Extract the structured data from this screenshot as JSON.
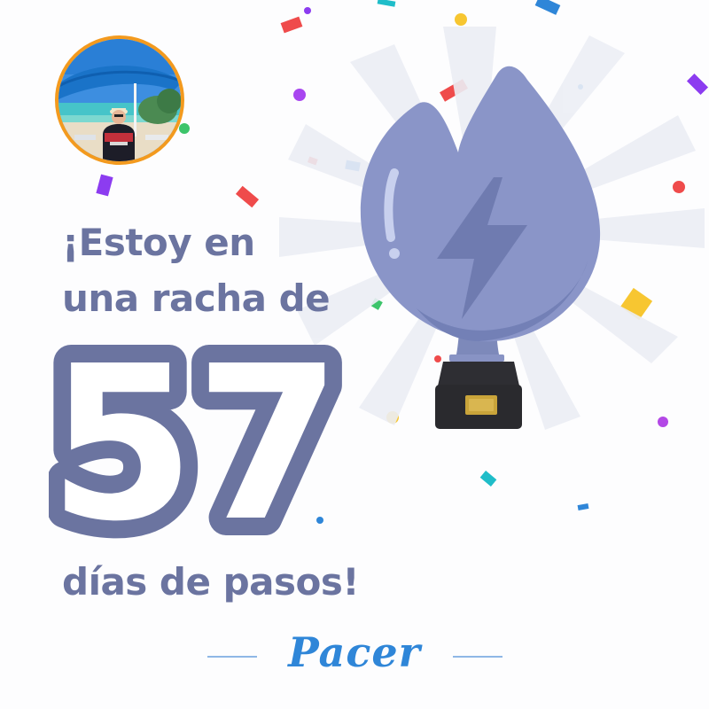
{
  "share_card": {
    "headline_line1": "¡Estoy en",
    "headline_line2": "una racha de",
    "streak_count": "57",
    "headline_line3": "días de pasos!",
    "brand": "Pacer"
  },
  "avatar": {
    "icon": "user-avatar-photo"
  },
  "trophy": {
    "icon": "lightning-bolt-icon"
  },
  "colors": {
    "text": "#6b74a0",
    "avatar_ring": "#f39a1e",
    "brand": "#2f86d8",
    "trophy_body": "#8a95c8",
    "trophy_base": "#2a2a2e",
    "plaque": "#c9a43a"
  }
}
